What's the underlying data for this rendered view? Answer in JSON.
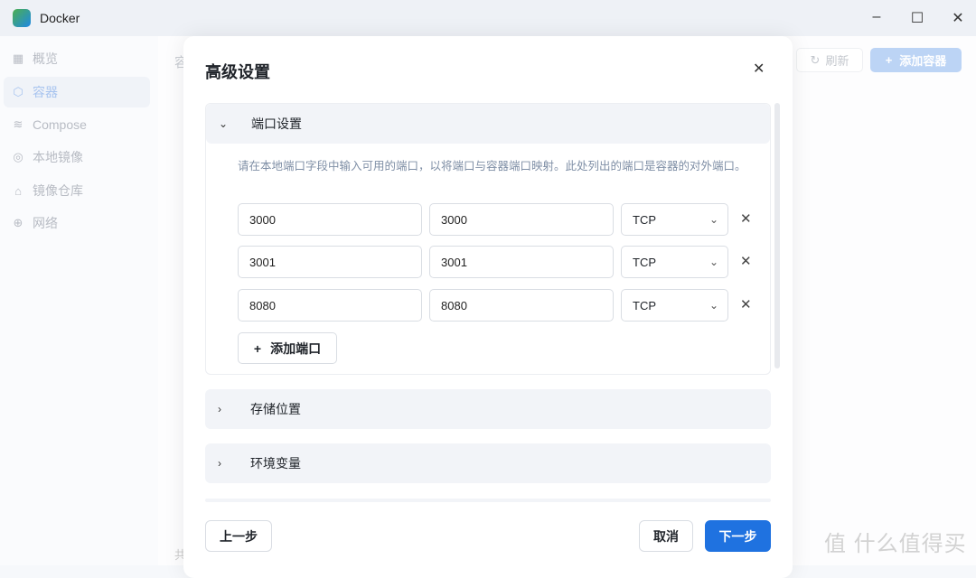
{
  "app": {
    "title": "Docker"
  },
  "sidebar": {
    "items": [
      {
        "label": "概览",
        "icon": "grid-icon"
      },
      {
        "label": "容器",
        "icon": "cube-icon",
        "active": true
      },
      {
        "label": "Compose",
        "icon": "layers-icon"
      },
      {
        "label": "本地镜像",
        "icon": "disk-icon"
      },
      {
        "label": "镜像仓库",
        "icon": "home-icon"
      },
      {
        "label": "网络",
        "icon": "globe-icon"
      }
    ]
  },
  "main": {
    "title": "容",
    "refresh": "刷新",
    "add_container": "添加容器",
    "footer": "共"
  },
  "modal": {
    "title": "高级设置",
    "sections": [
      {
        "label": "端口设置",
        "expanded": true,
        "description": "请在本地端口字段中输入可用的端口，以将端口与容器端口映射。此处列出的端口是容器的对外端口。",
        "ports": [
          {
            "local": "3000",
            "container": "3000",
            "protocol": "TCP"
          },
          {
            "local": "3001",
            "container": "3001",
            "protocol": "TCP"
          },
          {
            "local": "8080",
            "container": "8080",
            "protocol": "TCP"
          }
        ],
        "add_port": "添加端口"
      },
      {
        "label": "存储位置",
        "expanded": false
      },
      {
        "label": "环境变量",
        "expanded": false
      }
    ],
    "prev": "上一步",
    "cancel": "取消",
    "next": "下一步"
  },
  "watermark": "值 什么值得买",
  "colors": {
    "primary": "#1f72e0"
  }
}
